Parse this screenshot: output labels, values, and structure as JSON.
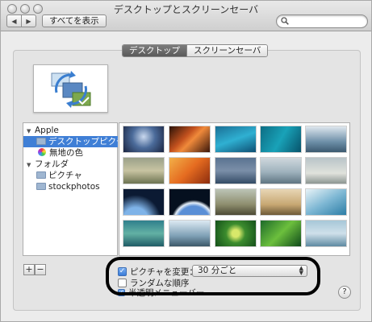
{
  "window": {
    "title": "デスクトップとスクリーンセーバ"
  },
  "toolbar": {
    "show_all": "すべてを表示",
    "search_placeholder": ""
  },
  "tabs": [
    {
      "label": "デスクトップ",
      "active": true
    },
    {
      "label": "スクリーンセーバ",
      "active": false
    }
  ],
  "sidebar": {
    "groups": [
      {
        "label": "Apple",
        "items": [
          "デスクトップピクチャ",
          "無地の色"
        ]
      },
      {
        "label": "フォルダ",
        "items": [
          "ピクチャ",
          "stockphotos"
        ]
      }
    ],
    "selected": "デスクトップピクチャ"
  },
  "controls": {
    "add": "+",
    "remove": "−",
    "change_picture_label": "ピクチャを変更：",
    "change_picture_checked": true,
    "interval": "30 分ごと",
    "random_label": "ランダムな順序",
    "random_checked": false,
    "partially_hidden_label": "半透明メニューバー",
    "help": "?"
  },
  "colors": {
    "selection": "#3f7fd6",
    "oval": "#000000"
  }
}
